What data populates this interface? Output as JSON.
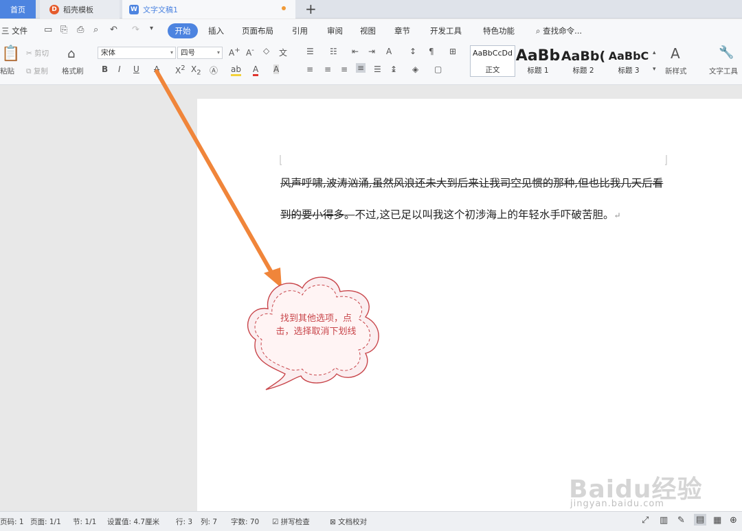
{
  "tabs": {
    "home": "首页",
    "template": "稻壳模板",
    "document": "文字文稿1",
    "add": "+"
  },
  "menu": {
    "file": "三 文件",
    "items": [
      "开始",
      "插入",
      "页面布局",
      "引用",
      "审阅",
      "视图",
      "章节",
      "开发工具",
      "特色功能"
    ],
    "search": "查找命令..."
  },
  "ribbon": {
    "paste": "粘贴",
    "cut": "剪切",
    "copy": "复制",
    "format_painter": "格式刷",
    "font_name": "宋体",
    "font_size": "四号",
    "styles": [
      {
        "sample": "AaBbCcDd",
        "label": "正文"
      },
      {
        "sample": "AaBb",
        "label": "标题 1"
      },
      {
        "sample": "AaBb(",
        "label": "标题 2"
      },
      {
        "sample": "AaBbC",
        "label": "标题 3"
      }
    ],
    "new_style": "新样式",
    "text_tools": "文字工具"
  },
  "document": {
    "struck_text": "风声呼啸,波涛汹涌,虽然风浪还未大到后来让我司空见惯的那种,但也比我几天后看到的要小得多。",
    "normal_text": "不过,这已足以叫我这个初涉海上的年轻水手吓破苦胆。",
    "paragraph_mark": "↵"
  },
  "annotation": {
    "callout": "找到其他选项，点击，选择取消下划线",
    "colors": {
      "arrow": "#f0853a",
      "cloud": "#c8454a"
    }
  },
  "status": {
    "page_num": "页码: 1",
    "pages": "页面: 1/1",
    "section": "节: 1/1",
    "setting": "设置值: 4.7厘米",
    "row": "行: 3",
    "col": "列: 7",
    "words": "字数: 70",
    "spell_check": "拼写检查",
    "proofread": "文档校对"
  },
  "watermark": {
    "brand": "Baidu经验",
    "url": "jingyan.baidu.com"
  },
  "colors": {
    "accent": "#4d84e0",
    "tab_bar": "#dfe3ea",
    "workspace": "#e8e8e8"
  }
}
